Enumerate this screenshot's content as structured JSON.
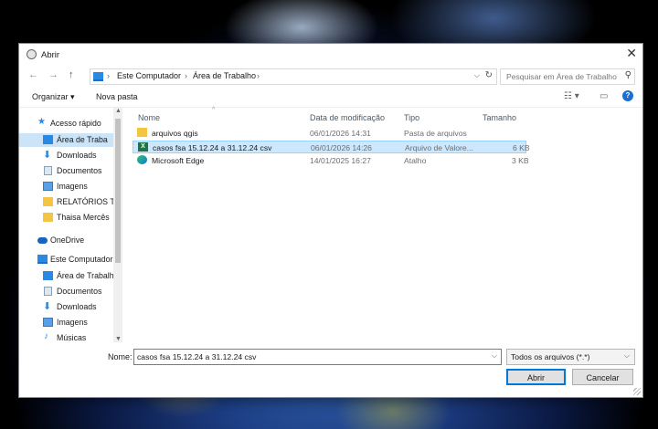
{
  "dialog": {
    "title": "Abrir",
    "close_symbol": "✕"
  },
  "nav": {
    "back": "←",
    "forward": "→",
    "up": "↑",
    "address": [
      "Este Computador",
      "Área de Trabalho"
    ],
    "separator": "›",
    "search_placeholder": "Pesquisar em Área de Trabalho"
  },
  "toolbar": {
    "organize": "Organizar ▾",
    "new_folder": "Nova pasta"
  },
  "sidebar": {
    "items": [
      {
        "label": "Acesso rápido",
        "icon": "star-icon"
      },
      {
        "label": "Área de Traba",
        "icon": "desktop-icon",
        "pinned": true
      },
      {
        "label": "Downloads",
        "icon": "download-icon",
        "pinned": true
      },
      {
        "label": "Documentos",
        "icon": "document-icon",
        "pinned": true
      },
      {
        "label": "Imagens",
        "icon": "image-icon",
        "pinned": true
      },
      {
        "label": "RELATÓRIOS TRI",
        "icon": "folder-icon"
      },
      {
        "label": "Thaisa Mercês",
        "icon": "folder-icon"
      },
      {
        "label": "OneDrive",
        "icon": "cloud-icon"
      },
      {
        "label": "Este Computador",
        "icon": "computer-icon"
      },
      {
        "label": "Área de Trabalho",
        "icon": "desktop-icon"
      },
      {
        "label": "Documentos",
        "icon": "document-icon"
      },
      {
        "label": "Downloads",
        "icon": "download-icon"
      },
      {
        "label": "Imagens",
        "icon": "image-icon"
      },
      {
        "label": "Músicas",
        "icon": "music-icon"
      }
    ]
  },
  "filelist": {
    "columns": [
      "Nome",
      "Data de modificação",
      "Tipo",
      "Tamanho"
    ],
    "rows": [
      {
        "name": "arquivos qgis",
        "date": "06/01/2026 14:31",
        "type": "Pasta de arquivos",
        "size": "",
        "icon": "folder-icon"
      },
      {
        "name": "casos fsa 15.12.24 a 31.12.24 csv",
        "date": "06/01/2026 14:26",
        "type": "Arquivo de Valore...",
        "size": "6 KB",
        "icon": "excel-icon",
        "selected": true
      },
      {
        "name": "Microsoft Edge",
        "date": "14/01/2025 16:27",
        "type": "Atalho",
        "size": "3 KB",
        "icon": "edge-icon"
      }
    ]
  },
  "footer": {
    "filename_label": "Nome:",
    "filename_value": "casos fsa 15.12.24 a 31.12.24 csv",
    "filetype_value": "Todos os arquivos (*.*)",
    "open_button": "Abrir",
    "cancel_button": "Cancelar"
  },
  "colors": {
    "accent": "#0078d7",
    "selection": "#cce8ff",
    "folder": "#f4c542"
  }
}
